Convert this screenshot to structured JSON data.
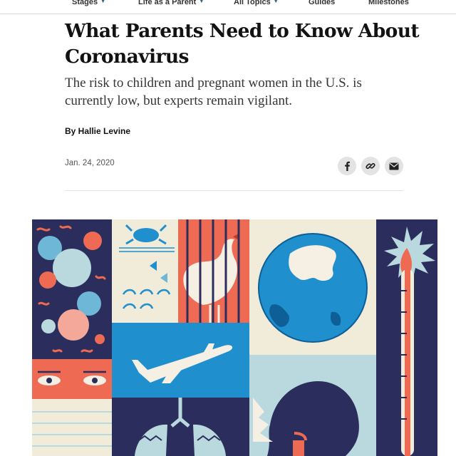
{
  "nav": {
    "items": [
      {
        "label": "Stages",
        "has_dropdown": true
      },
      {
        "label": "Life as a Parent",
        "has_dropdown": true
      },
      {
        "label": "All Topics",
        "has_dropdown": true
      },
      {
        "label": "Guides",
        "has_dropdown": false
      },
      {
        "label": "Milestones",
        "has_dropdown": false
      }
    ],
    "caret": "▼"
  },
  "article": {
    "headline": "What Parents Need to Know About Coronavirus",
    "summary": "The risk to children and pregnant women in the U.S. is currently low, but experts remain vigilant.",
    "byline": "By Hallie Levine",
    "date": "Jan. 24, 2020"
  },
  "share": {
    "icons": [
      "facebook-icon",
      "link-icon",
      "email-icon"
    ]
  },
  "colors": {
    "accent_blue": "#326891",
    "navy": "#2b2d5c",
    "coral": "#ee6a53",
    "sky": "#1f8fce",
    "cream": "#f1ebd9",
    "pale_blue": "#b9d9df",
    "share_bg": "#e3e3e3"
  }
}
